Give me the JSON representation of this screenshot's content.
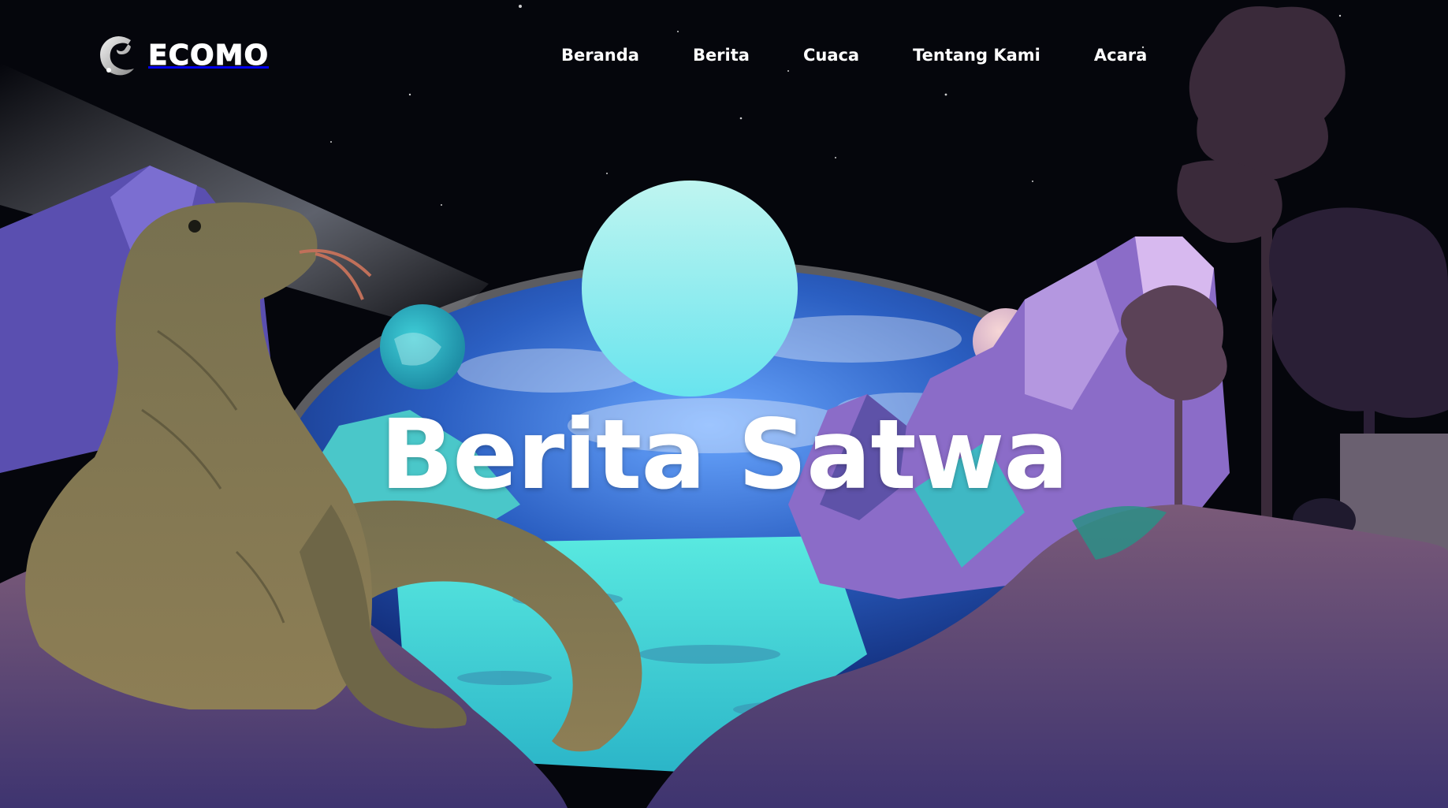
{
  "brand": {
    "name": "ECOMO",
    "logo_icon": "swirl-logo-icon"
  },
  "nav": {
    "items": [
      {
        "label": "Beranda"
      },
      {
        "label": "Berita"
      },
      {
        "label": "Cuaca"
      },
      {
        "label": "Tentang Kami"
      },
      {
        "label": "Acara"
      }
    ]
  },
  "hero": {
    "title": "Berita Satwa"
  },
  "colors": {
    "sky": "#05060c",
    "earth_blue": "#2f62c4",
    "moon_cyan": "#7fe7ec",
    "mountain_purple": "#7d5cc4",
    "ground_purple": "#4b3a7a",
    "tree_silhouette": "#3a2a3a",
    "komodo": "#7d7552",
    "text": "#ffffff"
  }
}
